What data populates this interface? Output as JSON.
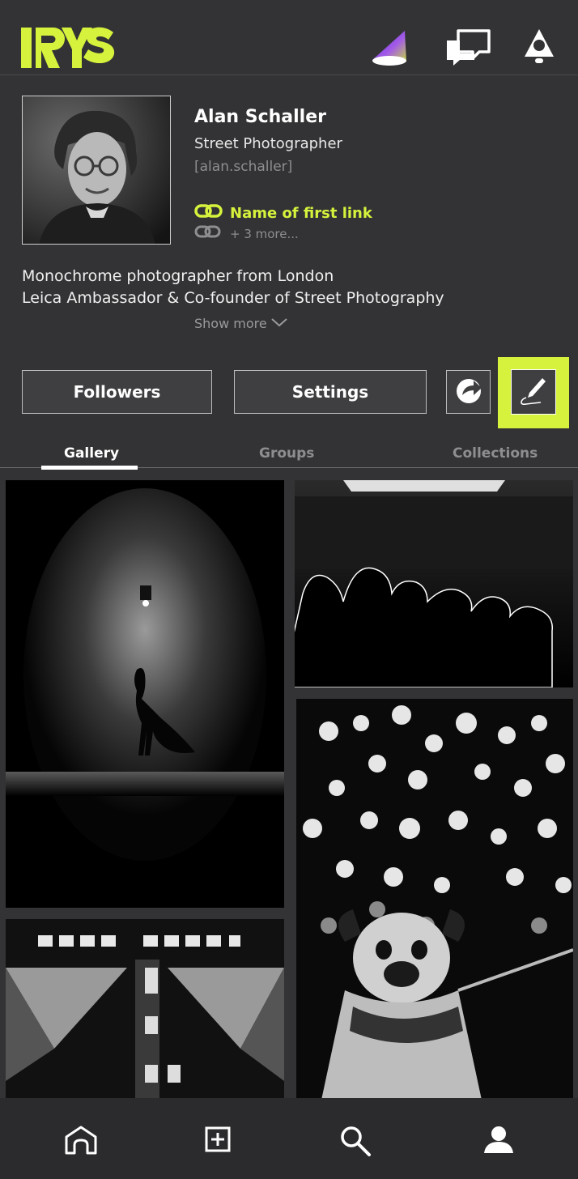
{
  "app": {
    "logo_text": "IRYS"
  },
  "header": {
    "icons": [
      "cone-icon",
      "chat-icon",
      "bell-icon"
    ],
    "accent_color": "#d6f23c"
  },
  "profile": {
    "name": "Alan Schaller",
    "role": "Street Photographer",
    "handle": "[alan.schaller]",
    "link_label": "Name of first link",
    "more_links": "+ 3 more...",
    "bio_line1": "Monochrome photographer from London",
    "bio_line2": "Leica Ambassador & Co-founder of Street Photography",
    "show_more": "Show more"
  },
  "actions": {
    "followers_label": "Followers",
    "settings_label": "Settings"
  },
  "tabs": [
    {
      "label": "Gallery",
      "active": true
    },
    {
      "label": "Groups",
      "active": false
    },
    {
      "label": "Collections",
      "active": false
    }
  ],
  "gallery": [
    {
      "subject": "woman walking under wall lamp"
    },
    {
      "subject": "crowd silhouettes"
    },
    {
      "subject": "pug with bokeh lights"
    },
    {
      "subject": "building facade"
    }
  ],
  "bottom_nav": [
    "home-icon",
    "add-icon",
    "search-icon",
    "profile-icon"
  ]
}
